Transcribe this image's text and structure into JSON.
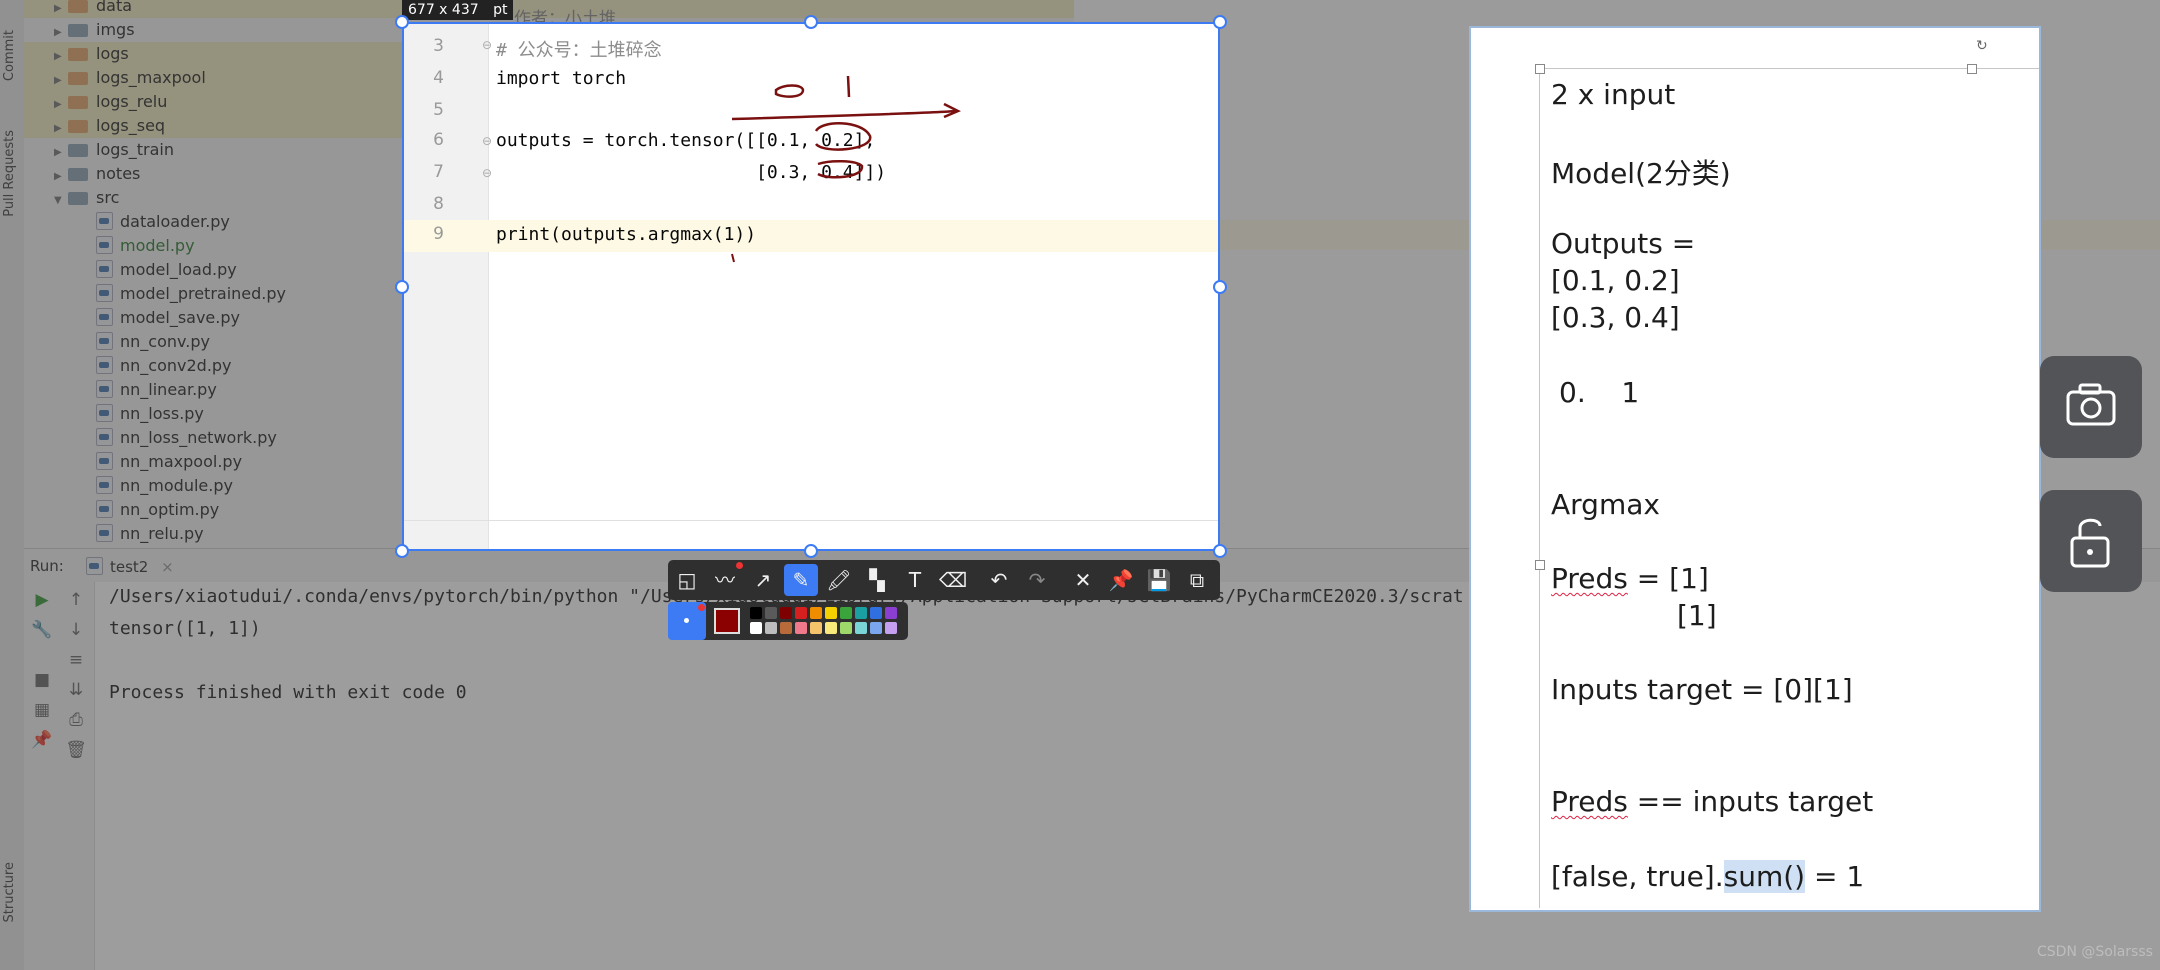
{
  "left_strip": {
    "tabs": [
      "Commit",
      "Pull Requests",
      "Structure"
    ]
  },
  "project_tree": {
    "folders": [
      {
        "name": "data",
        "expanded": false
      },
      {
        "name": "imgs",
        "expanded": false
      },
      {
        "name": "logs",
        "expanded": false
      },
      {
        "name": "logs_maxpool",
        "expanded": false
      },
      {
        "name": "logs_relu",
        "expanded": false
      },
      {
        "name": "logs_seq",
        "expanded": false
      },
      {
        "name": "logs_train",
        "expanded": false
      },
      {
        "name": "notes",
        "expanded": false
      },
      {
        "name": "src",
        "expanded": true
      }
    ],
    "files": [
      "dataloader.py",
      "model.py",
      "model_load.py",
      "model_pretrained.py",
      "model_save.py",
      "nn_conv.py",
      "nn_conv2d.py",
      "nn_linear.py",
      "nn_loss.py",
      "nn_loss_network.py",
      "nn_maxpool.py",
      "nn_module.py",
      "nn_optim.py",
      "nn_relu.py"
    ]
  },
  "editor_bg": {
    "author_comment": "作者：小土堆"
  },
  "capture": {
    "size_label": "677 x 437",
    "unit_label": "pt",
    "lines": [
      {
        "num": "3",
        "text": "# 公众号：土堆碎念"
      },
      {
        "num": "4",
        "text": "import torch"
      },
      {
        "num": "5",
        "text": ""
      },
      {
        "num": "6",
        "text": "outputs = torch.tensor([[0.1, 0.2],"
      },
      {
        "num": "7",
        "text": "                        [0.3, 0.4]])"
      },
      {
        "num": "8",
        "text": ""
      },
      {
        "num": "9",
        "text": "print(outputs.argmax(1))"
      }
    ]
  },
  "toolbar": {
    "tools": [
      "shape-tool",
      "polyline-tool",
      "arrow-tool",
      "pen-tool",
      "highlighter-tool",
      "mosaic-tool",
      "text-tool",
      "eraser-tool",
      "undo",
      "redo",
      "close",
      "pin",
      "save",
      "copy"
    ],
    "active_tool": "pen-tool",
    "current_color": "#8b0000",
    "palette_row1": [
      "#000000",
      "#5a5a5a",
      "#7f0000",
      "#d61f1f",
      "#f08c00",
      "#f5d000",
      "#3aa53a",
      "#1aa0a0",
      "#2f6fe0",
      "#8a3fd0"
    ],
    "palette_row2": [
      "#ffffff",
      "#bdbdbd",
      "#b86a3a",
      "#f07a8c",
      "#f5c36a",
      "#f7ea7a",
      "#9fd86a",
      "#7ad6d6",
      "#7aa6f0",
      "#c6a0f0"
    ]
  },
  "run_panel": {
    "label": "Run:",
    "tab": "test2",
    "console": [
      "/Users/xiaotudui/.conda/envs/pytorch/bin/python \"/Users/xiaotudui/Library/Application Support/JetBrains/PyCharmCE2020.3/scrat",
      "tensor([1, 1])",
      "",
      "Process finished with exit code 0"
    ]
  },
  "notes": {
    "lines": [
      "2 x input",
      "Model(2分类)",
      "Outputs =",
      "[0.1, 0.2]",
      "[0.3, 0.4]",
      "0.    1",
      "Argmax",
      "Preds",
      " = [1]",
      "[1]",
      "Inputs target = [0][1]",
      "Preds",
      " == inputs target",
      "[false, true].",
      "sum()",
      " = 1"
    ]
  },
  "side_buttons": [
    "camera-icon",
    "unlock-icon"
  ],
  "watermark": "CSDN @Solarsss"
}
